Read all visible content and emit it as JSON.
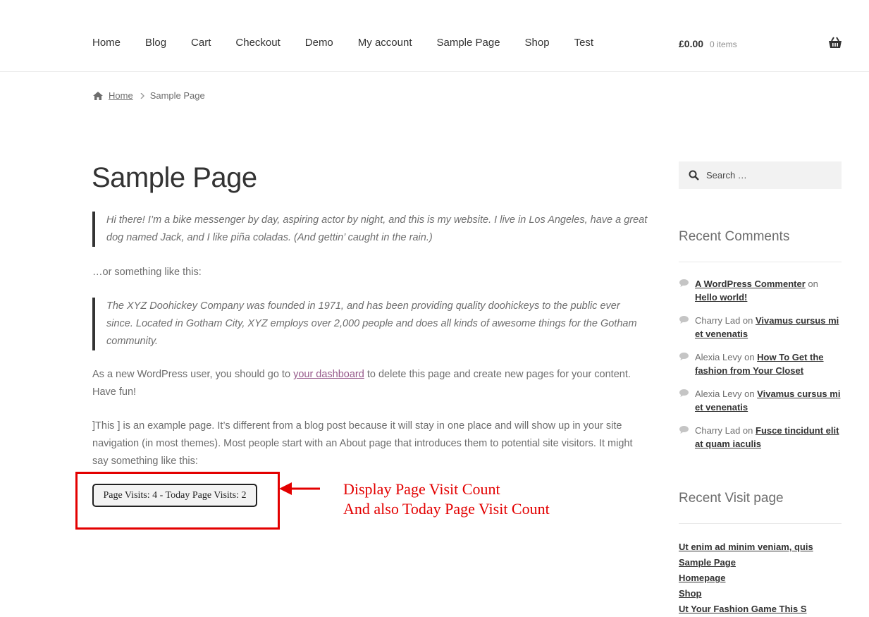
{
  "nav": {
    "items": [
      "Home",
      "Blog",
      "Cart",
      "Checkout",
      "Demo",
      "My account",
      "Sample Page",
      "Shop",
      "Test"
    ]
  },
  "cart": {
    "amount": "£0.00",
    "count": "0 items"
  },
  "breadcrumb": {
    "home": "Home",
    "current": "Sample Page"
  },
  "page": {
    "title": "Sample Page",
    "quote1": "Hi there! I’m a bike messenger by day, aspiring actor by night, and this is my website. I live in Los Angeles, have a great dog named Jack, and I like piña coladas. (And gettin’ caught in the rain.)",
    "para1": "…or something like this:",
    "quote2": "The XYZ Doohickey Company was founded in 1971, and has been providing quality doohickeys to the public ever since. Located in Gotham City, XYZ employs over 2,000 people and does all kinds of awesome things for the Gotham community.",
    "para2_before": "As a new WordPress user, you should go to ",
    "para2_link": "your dashboard",
    "para2_after": " to delete this page and create new pages for your content. Have fun!",
    "para3": "]This ] is an example page. It’s different from a blog post because it will stay in one place and will show up in your site navigation (in most themes). Most people start with an About page that introduces them to potential site visitors. It might say something like this:",
    "visit_counter": "Page Visits: 4 - Today Page Visits: 2"
  },
  "annotation": {
    "line1": "Display Page Visit Count",
    "line2": "And also Today Page Visit Count"
  },
  "sidebar": {
    "search_placeholder": "Search …",
    "recent_comments_title": "Recent Comments",
    "comments": [
      {
        "author": "A WordPress Commenter",
        "author_link": true,
        "on": " on ",
        "post": "Hello world!"
      },
      {
        "author": "Charry Lad",
        "author_link": false,
        "on": " on ",
        "post": "Vivamus cursus mi et venenatis"
      },
      {
        "author": "Alexia Levy",
        "author_link": false,
        "on": " on ",
        "post": "How To Get the fashion from Your Closet"
      },
      {
        "author": "Alexia Levy",
        "author_link": false,
        "on": " on ",
        "post": "Vivamus cursus mi et venenatis"
      },
      {
        "author": "Charry Lad",
        "author_link": false,
        "on": " on ",
        "post": "Fusce tincidunt elit at quam iaculis"
      }
    ],
    "recent_visit_title": "Recent Visit page",
    "visits": [
      "Ut enim ad minim veniam, quis",
      "Sample Page",
      "Homepage",
      "Shop",
      "Ut Your Fashion Game This S"
    ]
  },
  "colors": {
    "annotation_red": "#e30000",
    "link_purple": "#96588a",
    "text_dark": "#333333",
    "text_body": "#6d6d6d"
  },
  "icons": [
    "home-icon",
    "chevron-right-icon",
    "basket-icon",
    "search-icon",
    "comment-icon",
    "left-arrow-icon"
  ]
}
